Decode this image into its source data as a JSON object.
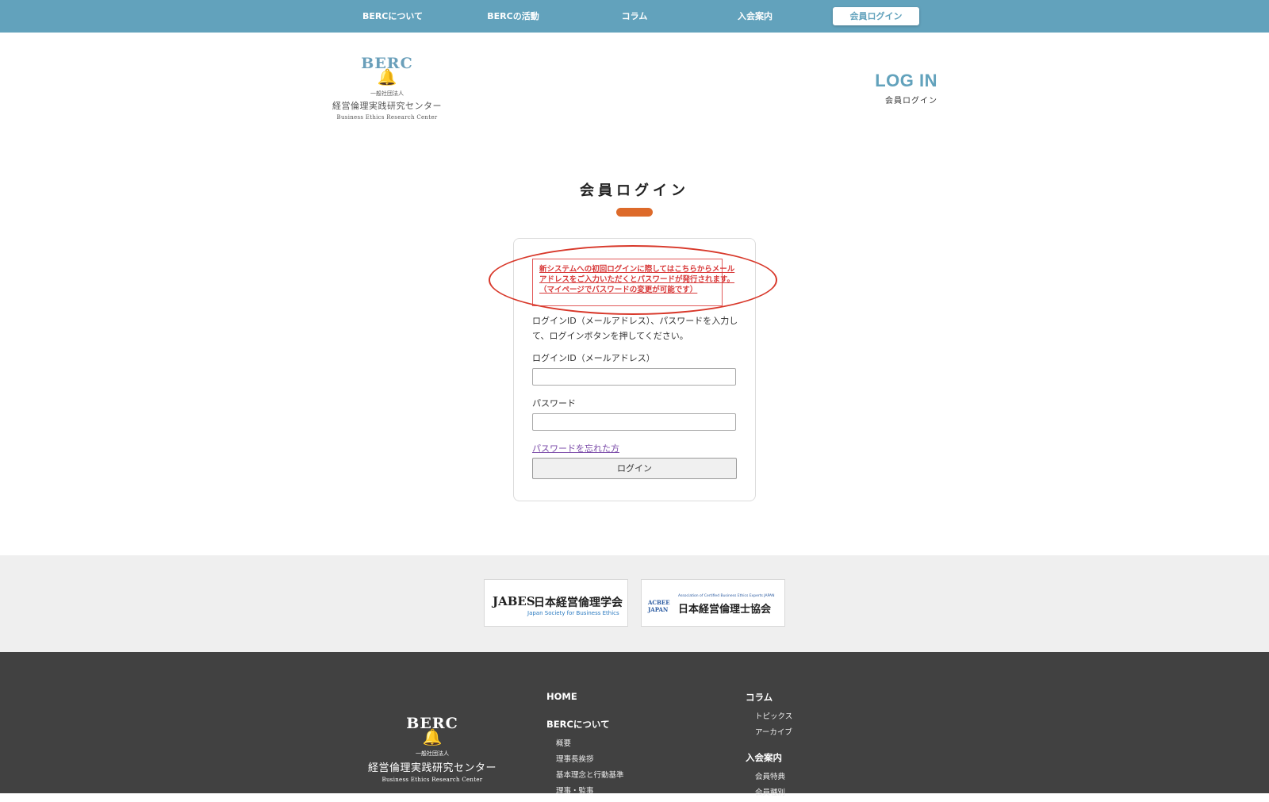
{
  "nav": {
    "items": [
      "BERCについて",
      "BERCの活動",
      "コラム",
      "入会案内"
    ],
    "login": "会員ログイン"
  },
  "logo": {
    "mark": "BERC",
    "line1": "一般社団法人",
    "line2": "経営倫理実践研究センター",
    "line3": "Business Ethics Research Center"
  },
  "header": {
    "title_en": "LOG IN",
    "title_ja": "会員ログイン"
  },
  "section": {
    "title": "会員ログイン"
  },
  "notice": {
    "line1": "新システムへの初回ログインに際してはこちらからメール",
    "line2": "アドレスをご入力いただくとパスワードが発行されます。",
    "line3": "（マイページでパスワードの変更が可能です）"
  },
  "form": {
    "intro_line1": "ログインID（メールアドレス）、パスワードを入力し",
    "intro_line2": "て、ログインボタンを押してください。",
    "id_label": "ログインID（メールアドレス）",
    "id_value": "",
    "password_label": "パスワード",
    "password_value": "",
    "forgot": "パスワードを忘れた方",
    "submit": "ログイン"
  },
  "partners": [
    {
      "mark": "JABES",
      "name": "日本経営倫理学会",
      "sub": "Japan Society for Business Ethics"
    },
    {
      "mark": "ACBEE JAPAN",
      "name": "日本経営倫理士協会",
      "sub": "Association of Certified Business Ethics Experts JAPAN"
    }
  ],
  "footer": {
    "col1": {
      "home": "HOME",
      "about": "BERCについて",
      "about_items": [
        "概要",
        "理事長挨拶",
        "基本理念と行動基準",
        "理事・監事"
      ]
    },
    "col2": {
      "column": "コラム",
      "column_items": [
        "トピックス",
        "アーカイブ"
      ],
      "join": "入会案内",
      "join_items": [
        "会員特典",
        "会員種別"
      ]
    }
  },
  "colors": {
    "nav_bg": "#62a2bc",
    "accent": "#dd6a2a",
    "notice_red": "#d83a3a",
    "footer_bg": "#414141"
  }
}
